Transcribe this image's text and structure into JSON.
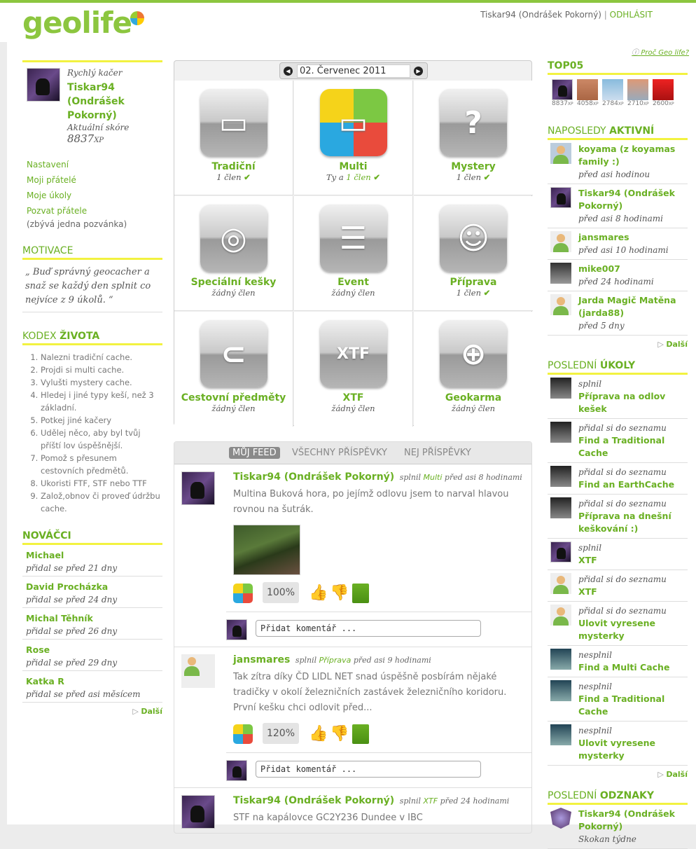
{
  "header": {
    "logo": "geolife",
    "user": "Tiskar94 (Ondrášek Pokorný)",
    "separator": "|",
    "logout": "ODHLÁSIT"
  },
  "profile": {
    "rank": "Rychlý kačer",
    "name": "Tiskar94 (Ondrášek Pokorný)",
    "score_label": "Aktuální skóre",
    "score": "8837",
    "score_unit": "XP",
    "links": [
      "Nastavení",
      "Moji přátelé",
      "Moje úkoly",
      "Pozvat přátele"
    ],
    "invite_note": "(zbývá jedna pozvánka)"
  },
  "motivace": {
    "title": "MOTIVACE",
    "text": "„ Buď správný geocacher a snaž se každý den splnit co nejvíce z 9 úkolů. “"
  },
  "kodex": {
    "title_a": "KODEX ",
    "title_b": "ŽIVOTA",
    "items": [
      "Nalezni tradiční cache.",
      "Projdi si multi cache.",
      "Vylušti mystery cache.",
      "Hledej i jiné typy keší, než 3 základní.",
      "Potkej jiné kačery",
      "Udělej něco, aby byl tvůj příští lov úspěšnější.",
      "Pomož s přesunem cestovních předmětů.",
      "Ukoristi FTF, STF nebo TTF",
      "Založ,obnov či proveď údržbu cache."
    ]
  },
  "novacci": {
    "title": "NOVÁČCI",
    "items": [
      {
        "name": "Michael",
        "when": "přidal se před 21 dny"
      },
      {
        "name": "David Procházka",
        "when": "přidal se před 24 dny"
      },
      {
        "name": "Michal Těhník",
        "when": "přidal se před 26 dny"
      },
      {
        "name": "Rose",
        "when": "přidal se před 29 dny"
      },
      {
        "name": "Katka R",
        "when": "přidal se před asi měsícem"
      }
    ],
    "more": "Další"
  },
  "date": {
    "value": "02. Červenec 2011",
    "prev": "◀",
    "next": "▶"
  },
  "tasks": [
    {
      "label": "Tradiční",
      "status": "1 člen",
      "check": "✔",
      "glyph": "▭"
    },
    {
      "label": "Multi",
      "status_prefix": "Ty a ",
      "status": "1 člen",
      "check": "✔",
      "glyph": "▭"
    },
    {
      "label": "Mystery",
      "status": "1 člen",
      "check": "✔",
      "glyph": "?"
    },
    {
      "label": "Speciální kešky",
      "status": "žádný člen",
      "glyph": "◎"
    },
    {
      "label": "Event",
      "status": "žádný člen",
      "glyph": "☰"
    },
    {
      "label": "Příprava",
      "status": "1 člen",
      "check": "✔",
      "glyph": "☺"
    },
    {
      "label": "Cestovní předměty",
      "status": "žádný člen",
      "glyph": "⊂"
    },
    {
      "label": "XTF",
      "status": "žádný člen",
      "glyph": "XTF"
    },
    {
      "label": "Geokarma",
      "status": "žádný člen",
      "glyph": "⊕"
    }
  ],
  "feed": {
    "tabs": [
      "MŮJ FEED",
      "VŠECHNY PŘÍSPĚVKY",
      "NEJ PŘÍSPĚVKY"
    ],
    "comment_placeholder": "Přidat komentář ...",
    "posts": [
      {
        "author": "Tiskar94 (Ondrášek Pokorný)",
        "verb": "splnil",
        "task": "Multi",
        "when": "před asi 8 hodinami",
        "text": "Multina Buková hora, po jejímž odlovu jsem to narval hlavou rovnou na šutrák.",
        "percent": "100%"
      },
      {
        "author": "jansmares",
        "verb": "splnil",
        "task": "Příprava",
        "when": "před asi 9 hodinami",
        "text": "Tak zítra díky ČD LIDL NET snad úspěšně posbírám nějaké tradičky v okolí železničních zastávek železničního koridoru. První kešku chci odlovit před...",
        "percent": "120%"
      },
      {
        "author": "Tiskar94 (Ondrášek Pokorný)",
        "verb": "splnil",
        "task": "XTF",
        "when": "před 24 hodinami",
        "text": "STF na kapálovce GC2Y236 Dundee v IBC"
      }
    ]
  },
  "right": {
    "why": "Proč Geo life?",
    "top5_title": "TOP05",
    "top5": [
      {
        "xp": "8837",
        "unit": "XP"
      },
      {
        "xp": "4058",
        "unit": "XP"
      },
      {
        "xp": "2784",
        "unit": "XP"
      },
      {
        "xp": "2710",
        "unit": "XP"
      },
      {
        "xp": "2600",
        "unit": "XP"
      }
    ],
    "active_title_a": "NAPOSLEDY ",
    "active_title_b": "AKTIVNÍ",
    "active": [
      {
        "name": "koyama (z koyamas family :)",
        "when": "před asi hodinou"
      },
      {
        "name": "Tiskar94 (Ondrášek Pokorný)",
        "when": "před asi 8 hodinami"
      },
      {
        "name": "jansmares",
        "when": "před asi 10 hodinami"
      },
      {
        "name": "mike007",
        "when": "před 24 hodinami"
      },
      {
        "name": "Jarda Magič Matěna (jarda88)",
        "when": "před 5 dny"
      }
    ],
    "more": "Další",
    "tasks_title_a": "POSLEDNÍ ",
    "tasks_title_b": "ÚKOLY",
    "recent_tasks": [
      {
        "verb": "splnil",
        "name": "Příprava na odlov kešek"
      },
      {
        "verb": "přidal si do seznamu",
        "name": "Find a Traditional Cache"
      },
      {
        "verb": "přidal si do seznamu",
        "name": "Find an EarthCache"
      },
      {
        "verb": "přidal si do seznamu",
        "name": "Příprava na dnešní keškování :)"
      },
      {
        "verb": "splnil",
        "name": "XTF"
      },
      {
        "verb": "přidal si do seznamu",
        "name": "XTF"
      },
      {
        "verb": "přidal si do seznamu",
        "name": "Ulovit vyresene mysterky"
      },
      {
        "verb": "nesplnil",
        "name": "Find a Multi Cache"
      },
      {
        "verb": "nesplnil",
        "name": "Find a Traditional Cache"
      },
      {
        "verb": "nesplnil",
        "name": "Ulovit vyresene mysterky"
      }
    ],
    "badges_title_a": "POSLEDNÍ ",
    "badges_title_b": "ODZNAKY",
    "badges": [
      {
        "name": "Tiskar94 (Ondrášek Pokorný)",
        "badge": "Skokan týdne"
      }
    ]
  },
  "colors": {
    "accent": "#6ab023",
    "underline": "#f2f240"
  }
}
